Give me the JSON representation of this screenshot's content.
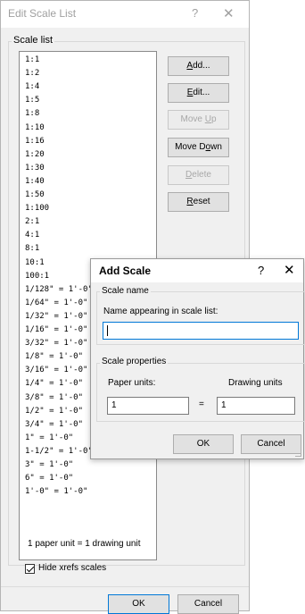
{
  "edit_scale_list": {
    "title": "Edit Scale List",
    "help_glyph": "?",
    "close_glyph": "✕",
    "group_label": "Scale list",
    "scales": [
      "1:1",
      "1:2",
      "1:4",
      "1:5",
      "1:8",
      "1:10",
      "1:16",
      "1:20",
      "1:30",
      "1:40",
      "1:50",
      "1:100",
      "2:1",
      "4:1",
      "8:1",
      "10:1",
      "100:1",
      "1/128\" = 1'-0\"",
      "1/64\" = 1'-0\"",
      "1/32\" = 1'-0\"",
      "1/16\" = 1'-0\"",
      "3/32\" = 1'-0\"",
      "1/8\" = 1'-0\"",
      "3/16\" = 1'-0\"",
      "1/4\" = 1'-0\"",
      "3/8\" = 1'-0\"",
      "1/2\" = 1'-0\"",
      "3/4\" = 1'-0\"",
      "1\" = 1'-0\"",
      "1-1/2\" = 1'-0\"",
      "3\" = 1'-0\"",
      "6\" = 1'-0\"",
      "1'-0\" = 1'-0\""
    ],
    "buttons": {
      "add": "Add...",
      "edit": "Edit...",
      "move_up": "Move Up",
      "move_down": "Move Down",
      "delete": "Delete",
      "reset": "Reset"
    },
    "summary": "1 paper unit = 1 drawing unit",
    "hide_xrefs_label": "Hide xrefs scales",
    "hide_xrefs_checked": true,
    "ok": "OK",
    "cancel": "Cancel"
  },
  "add_scale": {
    "title": "Add Scale",
    "help_glyph": "?",
    "close_glyph": "✕",
    "scale_name_group": "Scale name",
    "name_label": "Name appearing in scale list:",
    "name_value": "",
    "scale_props_group": "Scale properties",
    "paper_units_label": "Paper units:",
    "drawing_units_label": "Drawing units",
    "equals": "=",
    "paper_units_value": "1",
    "drawing_units_value": "1",
    "ok": "OK",
    "cancel": "Cancel"
  }
}
